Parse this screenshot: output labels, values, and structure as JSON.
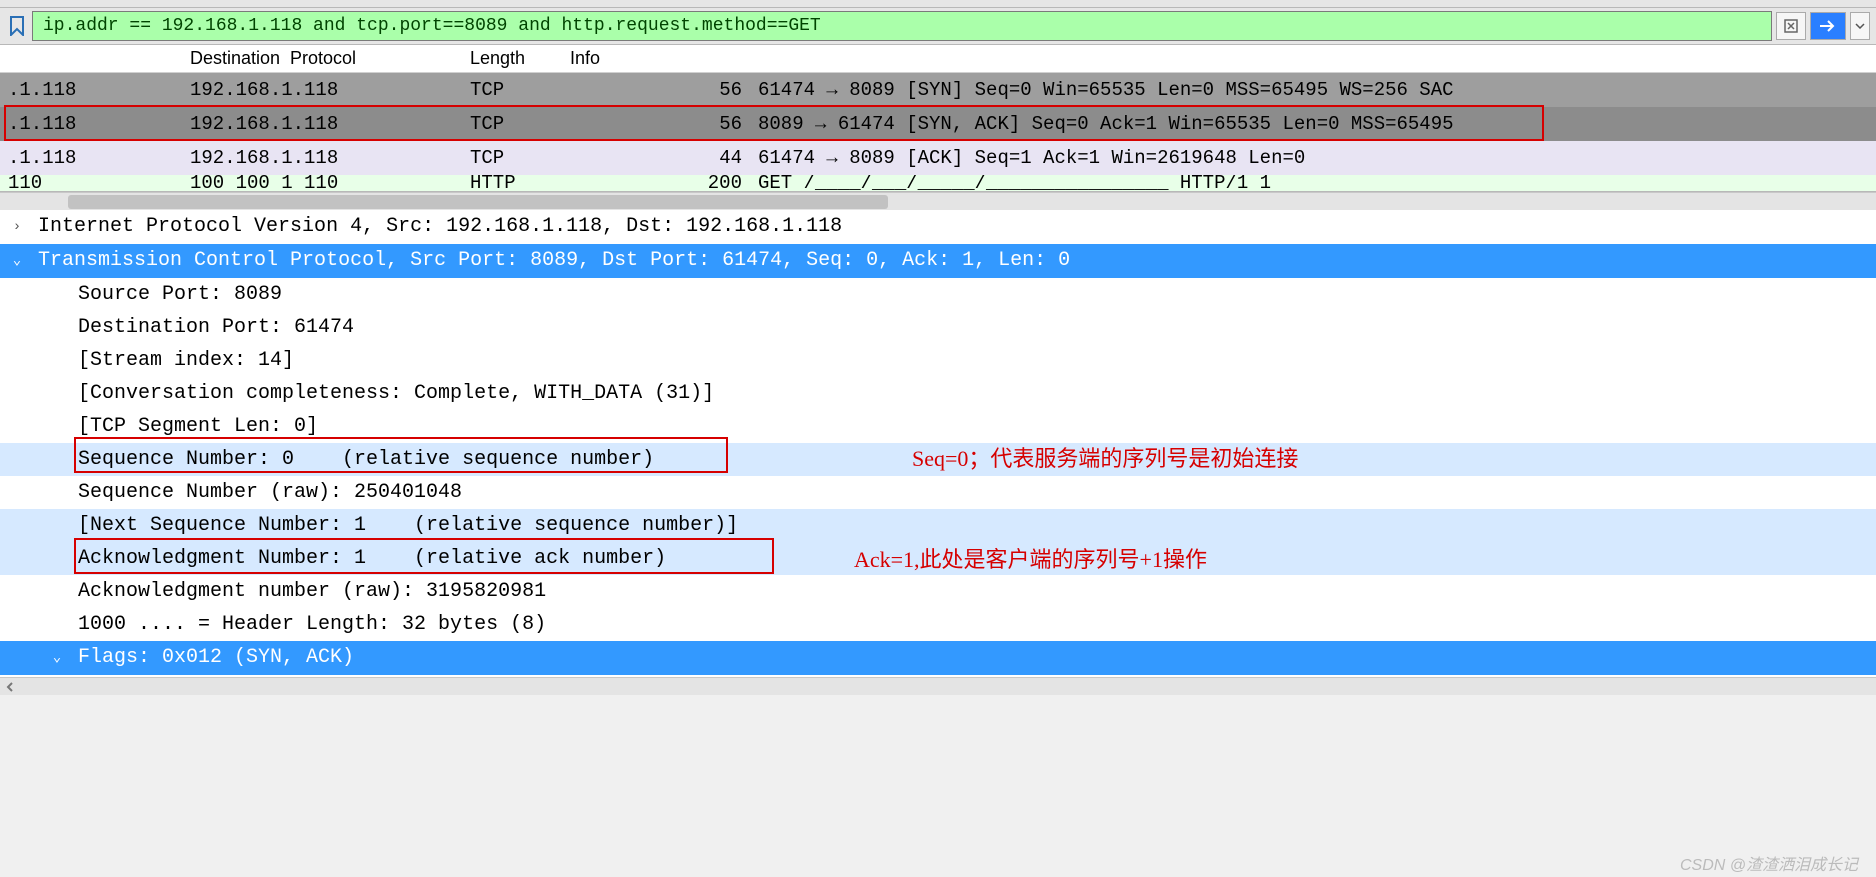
{
  "filter": {
    "expression": "ip.addr == 192.168.1.118 and tcp.port==8089 and http.request.method==GET"
  },
  "columns": {
    "destination": "Destination",
    "protocol": "Protocol",
    "length": "Length",
    "info": "Info"
  },
  "packets": [
    {
      "src": ".1.118",
      "dst": "192.168.1.118",
      "proto": "TCP",
      "len": "56",
      "info": "61474 → 8089 [SYN] Seq=0 Win=65535 Len=0 MSS=65495 WS=256 SAC",
      "cls": "r-gray"
    },
    {
      "src": ".1.118",
      "dst": "192.168.1.118",
      "proto": "TCP",
      "len": "56",
      "info": "8089 → 61474 [SYN, ACK] Seq=0 Ack=1 Win=65535 Len=0 MSS=65495",
      "cls": "r-sel"
    },
    {
      "src": ".1.118",
      "dst": "192.168.1.118",
      "proto": "TCP",
      "len": "44",
      "info": "61474 → 8089 [ACK] Seq=1 Ack=1 Win=2619648 Len=0",
      "cls": "r-purple"
    },
    {
      "src": "  110",
      "dst": "100 100 1 110",
      "proto": "HTTP",
      "len": "200",
      "info": "GET /____/___/_____/________________ HTTP/1 1",
      "cls": "r-green-cut"
    }
  ],
  "detail": {
    "ipv4": "Internet Protocol Version 4, Src: 192.168.1.118, Dst: 192.168.1.118",
    "tcp_header": "Transmission Control Protocol, Src Port: 8089, Dst Port: 61474, Seq: 0, Ack: 1, Len: 0",
    "src_port": "Source Port: 8089",
    "dst_port": "Destination Port: 61474",
    "stream_index": "[Stream index: 14]",
    "conv": "[Conversation completeness: Complete, WITH_DATA (31)]",
    "seg_len": "[TCP Segment Len: 0]",
    "seq": "Sequence Number: 0    (relative sequence number)",
    "seq_raw": "Sequence Number (raw): 250401048",
    "next_seq": "[Next Sequence Number: 1    (relative sequence number)]",
    "ack": "Acknowledgment Number: 1    (relative ack number)",
    "ack_raw": "Acknowledgment number (raw): 3195820981",
    "header_len": "1000 .... = Header Length: 32 bytes (8)",
    "flags": "Flags: 0x012 (SYN, ACK)"
  },
  "annotations": {
    "seq_note": "Seq=0；代表服务端的序列号是初始连接",
    "ack_note": "Ack=1,此处是客户端的序列号+1操作"
  },
  "watermark": "CSDN @渣渣洒泪成长记"
}
